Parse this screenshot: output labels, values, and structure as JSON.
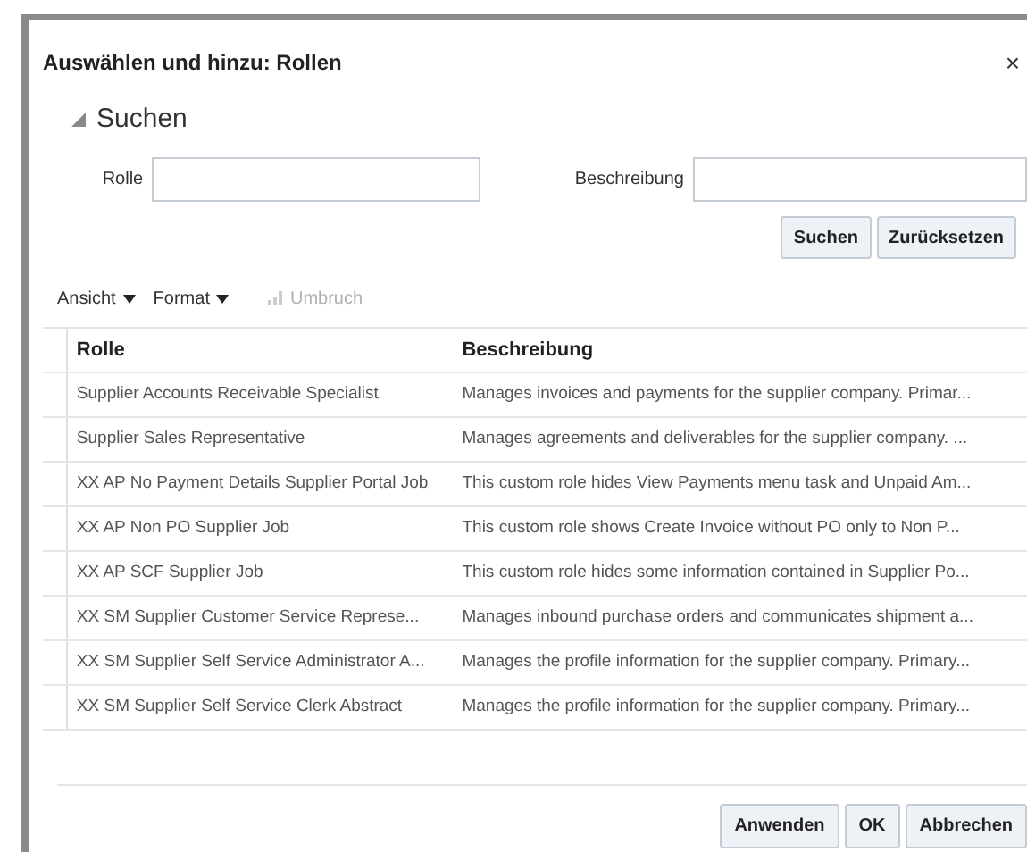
{
  "dialog": {
    "title": "Auswählen und hinzu: Rollen",
    "close": "×"
  },
  "search": {
    "heading": "Suchen",
    "expanded": true,
    "fields": [
      {
        "label": "Rolle"
      },
      {
        "label": "Beschreibung"
      }
    ],
    "buttons": [
      "Suchen",
      "Zurücksetzen"
    ]
  },
  "toolbar": {
    "menus": [
      "Ansicht",
      "Format"
    ],
    "wrap": {
      "label": "Umbruch",
      "disabled": true
    }
  },
  "table": {
    "columns": [
      "Rolle",
      "Beschreibung"
    ],
    "rows": [
      [
        "Supplier Accounts Receivable Specialist",
        "Manages invoices and payments for the supplier company. Primar..."
      ],
      [
        "Supplier Sales Representative",
        "Manages agreements and deliverables for the supplier company. ..."
      ],
      [
        "XX AP No Payment Details Supplier Portal Job",
        "This custom role hides View Payments menu task and Unpaid Am..."
      ],
      [
        "XX AP Non PO Supplier Job",
        "This custom role shows Create Invoice without PO only to Non P..."
      ],
      [
        "XX AP SCF Supplier Job",
        "This custom role hides some information contained in Supplier Po..."
      ],
      [
        "XX SM Supplier Customer Service Represe...",
        "Manages inbound purchase orders and communicates shipment a..."
      ],
      [
        "XX SM Supplier Self Service Administrator A...",
        "Manages the profile information for the supplier company. Primary..."
      ],
      [
        "XX SM Supplier Self Service Clerk Abstract",
        "Manages the profile information for the supplier company. Primary..."
      ]
    ]
  },
  "footer_buttons": [
    "Anwenden",
    "OK",
    "Abbrechen"
  ]
}
